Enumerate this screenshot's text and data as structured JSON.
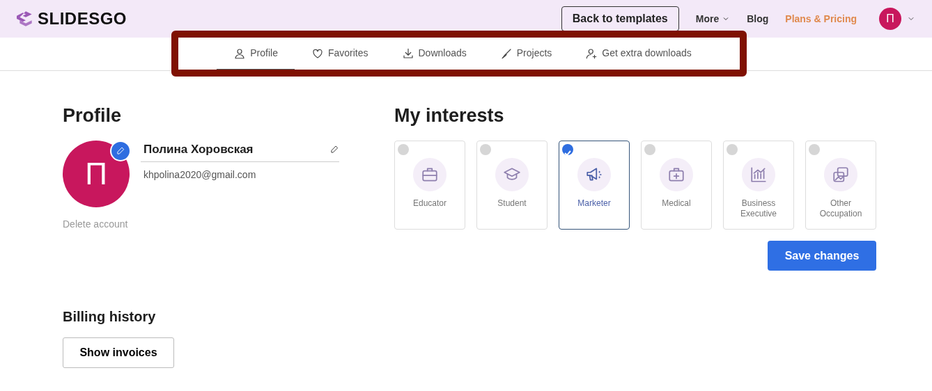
{
  "header": {
    "logo": "SLIDESGO",
    "back_button": "Back to templates",
    "nav": [
      {
        "label": "More",
        "dropdown": true,
        "highlight": false
      },
      {
        "label": "Blog",
        "dropdown": false,
        "highlight": false
      },
      {
        "label": "Plans & Pricing",
        "dropdown": false,
        "highlight": true
      }
    ],
    "avatar": "П"
  },
  "tabs": [
    {
      "label": "Profile",
      "kind": "person",
      "selected": true
    },
    {
      "label": "Favorites",
      "kind": "heart",
      "selected": false
    },
    {
      "label": "Downloads",
      "kind": "download",
      "selected": false
    },
    {
      "label": "Projects",
      "kind": "brush",
      "selected": false
    },
    {
      "label": "Get extra downloads",
      "kind": "person-plus",
      "selected": false
    }
  ],
  "profile": {
    "title": "Profile",
    "avatar": "П",
    "name": "Полина Хоровская",
    "email": "khpolina2020@gmail.com",
    "delete_link": "Delete account"
  },
  "interests": {
    "title": "My interests",
    "items": [
      {
        "label": "Educator",
        "kind": "briefcase",
        "selected": false
      },
      {
        "label": "Student",
        "kind": "cap",
        "selected": false
      },
      {
        "label": "Marketer",
        "kind": "megaphone",
        "selected": true
      },
      {
        "label": "Medical",
        "kind": "medkit",
        "selected": false
      },
      {
        "label": "Business Executive",
        "kind": "chart",
        "selected": false
      },
      {
        "label": "Other Occupation",
        "kind": "images",
        "selected": false
      }
    ],
    "save_button": "Save changes"
  },
  "billing": {
    "title": "Billing history",
    "button": "Show invoices"
  }
}
